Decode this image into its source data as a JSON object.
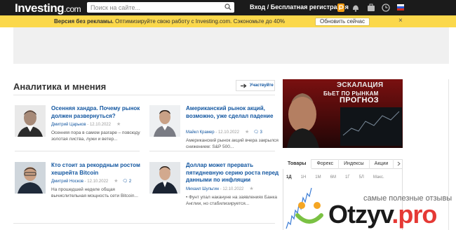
{
  "header": {
    "logo": "Investing",
    "logo_suffix": ".com",
    "search_placeholder": "Поиск на сайте...",
    "auth_label": "Вход / Бесплатная регистрация",
    "icons": [
      "pro-badge-icon",
      "bell-icon",
      "portfolio-icon",
      "clock-icon",
      "russia-flag-icon"
    ]
  },
  "notice": {
    "title": "Версия без рекламы.",
    "text": "Оптимизируйте свою работу с Investing.com. Сэкономьте до 40%",
    "button": "Обновить сейчас",
    "close": "×"
  },
  "section": {
    "title": "Аналитика и мнения",
    "participate": "Участвуйте"
  },
  "articles": [
    {
      "title": "Осенняя хандра. Почему рынок должен развернуться?",
      "author": "Дмитрий Царьков",
      "date": "12.10.2022",
      "comments": "",
      "desc": "Осенняя пора в самом разгаре – повсюду золотая листва, лужи и ветер..."
    },
    {
      "title": "Американский рынок акций, возможно, уже сделал падение",
      "author": "Майкл Крамер",
      "date": "12.10.2022",
      "comments": "3",
      "desc": "Американский рынок акций вчера закрылся снижением: S&P 500..."
    },
    {
      "title": "Кто стоит за рекордным ростом хешрейта Bitcoin",
      "author": "Дмитрий Носков",
      "date": "12.10.2022",
      "comments": "2",
      "desc": "На прошедшей неделе общая вычислительная мощность сети Bitcoin..."
    },
    {
      "title": "Доллар может прервать пятидневную серию роста перед данными по инфляции",
      "author": "Михаил Шульгин",
      "date": "12.10.2022",
      "comments": "",
      "desc": "• Фунт упал накануне на заявлениях Банка Англии, но стабилизируется..."
    }
  ],
  "video": {
    "line1": "ЭСКАЛАЦИЯ",
    "line2": "БЬЕТ ПО РЫНКАМ",
    "line3": "ПРОГНОЗ"
  },
  "market_tabs": {
    "tabs": [
      "Товары",
      "Форекс",
      "Индексы",
      "Акции"
    ],
    "active": "Товары",
    "periods": [
      "1Д",
      "1Н",
      "1М",
      "6М",
      "1Г",
      "5Л",
      "Макс."
    ],
    "active_period": "1Д"
  },
  "watermark": {
    "caption": "самые полезные отзывы",
    "brand_main": "Otzyv",
    "brand_suffix": ".pro"
  },
  "colors": {
    "topbar": "#1b1b1b",
    "notice": "#fbd84b",
    "link": "#1256a0",
    "watermark_accent": "#e53935"
  }
}
